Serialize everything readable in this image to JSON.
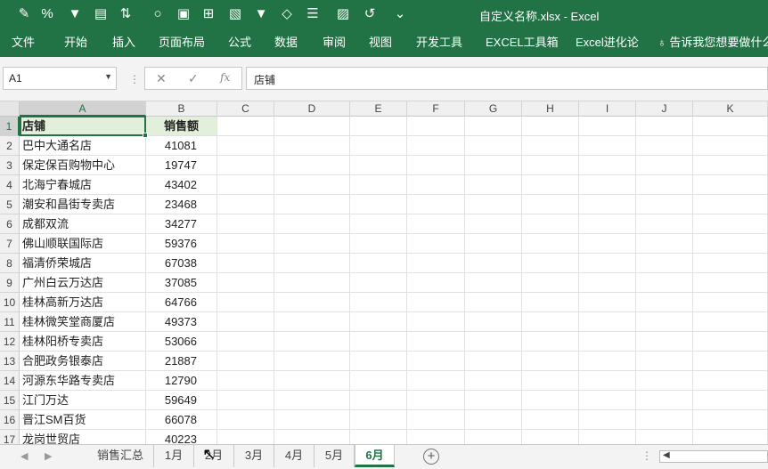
{
  "window_title": "自定义名称.xlsx  -  Excel",
  "qat": {
    "icons": [
      "brush-icon",
      "percent-icon",
      "filter-icon",
      "paste-icon",
      "sort-icon",
      "circle-icon",
      "chart-icon",
      "grid-icon",
      "chart2-icon",
      "filter2-icon",
      "eraser-icon",
      "form-icon",
      "image-icon",
      "loop-icon",
      "more-icon"
    ]
  },
  "ribbon": {
    "tabs": [
      "文件",
      "开始",
      "插入",
      "页面布局",
      "公式",
      "数据",
      "审阅",
      "视图",
      "开发工具",
      "EXCEL工具箱",
      "Excel进化论",
      "告诉我您想要做什么"
    ]
  },
  "formula_bar": {
    "name_box": "A1",
    "cancel": "✕",
    "confirm": "✓",
    "fx": "fx",
    "content": "店铺"
  },
  "columns": [
    "A",
    "B",
    "C",
    "D",
    "E",
    "F",
    "G",
    "H",
    "I",
    "J",
    "K"
  ],
  "rows": [
    {
      "n": "1",
      "a": "店铺",
      "b": "销售额"
    },
    {
      "n": "2",
      "a": "巴中大通名店",
      "b": "41081"
    },
    {
      "n": "3",
      "a": "保定保百购物中心",
      "b": "19747"
    },
    {
      "n": "4",
      "a": "北海宁春城店",
      "b": "43402"
    },
    {
      "n": "5",
      "a": "潮安和昌街专卖店",
      "b": "23468"
    },
    {
      "n": "6",
      "a": "成都双流",
      "b": "34277"
    },
    {
      "n": "7",
      "a": "佛山顺联国际店",
      "b": "59376"
    },
    {
      "n": "8",
      "a": "福清侨荣城店",
      "b": "67038"
    },
    {
      "n": "9",
      "a": "广州白云万达店",
      "b": "37085"
    },
    {
      "n": "10",
      "a": "桂林高新万达店",
      "b": "64766"
    },
    {
      "n": "11",
      "a": "桂林微笑堂商厦店",
      "b": "49373"
    },
    {
      "n": "12",
      "a": "桂林阳桥专卖店",
      "b": "53066"
    },
    {
      "n": "13",
      "a": "合肥政务银泰店",
      "b": "21887"
    },
    {
      "n": "14",
      "a": "河源东华路专卖店",
      "b": "12790"
    },
    {
      "n": "15",
      "a": "江门万达",
      "b": "59649"
    },
    {
      "n": "16",
      "a": "晋江SM百货",
      "b": "66078"
    },
    {
      "n": "17",
      "a": "龙岗世贸店",
      "b": "40223"
    }
  ],
  "sheets": {
    "tabs": [
      "销售汇总",
      "1月",
      "2月",
      "3月",
      "4月",
      "5月",
      "6月"
    ],
    "active": "6月"
  },
  "colors": {
    "accent": "#217346",
    "header_fill": "#e2efda"
  }
}
